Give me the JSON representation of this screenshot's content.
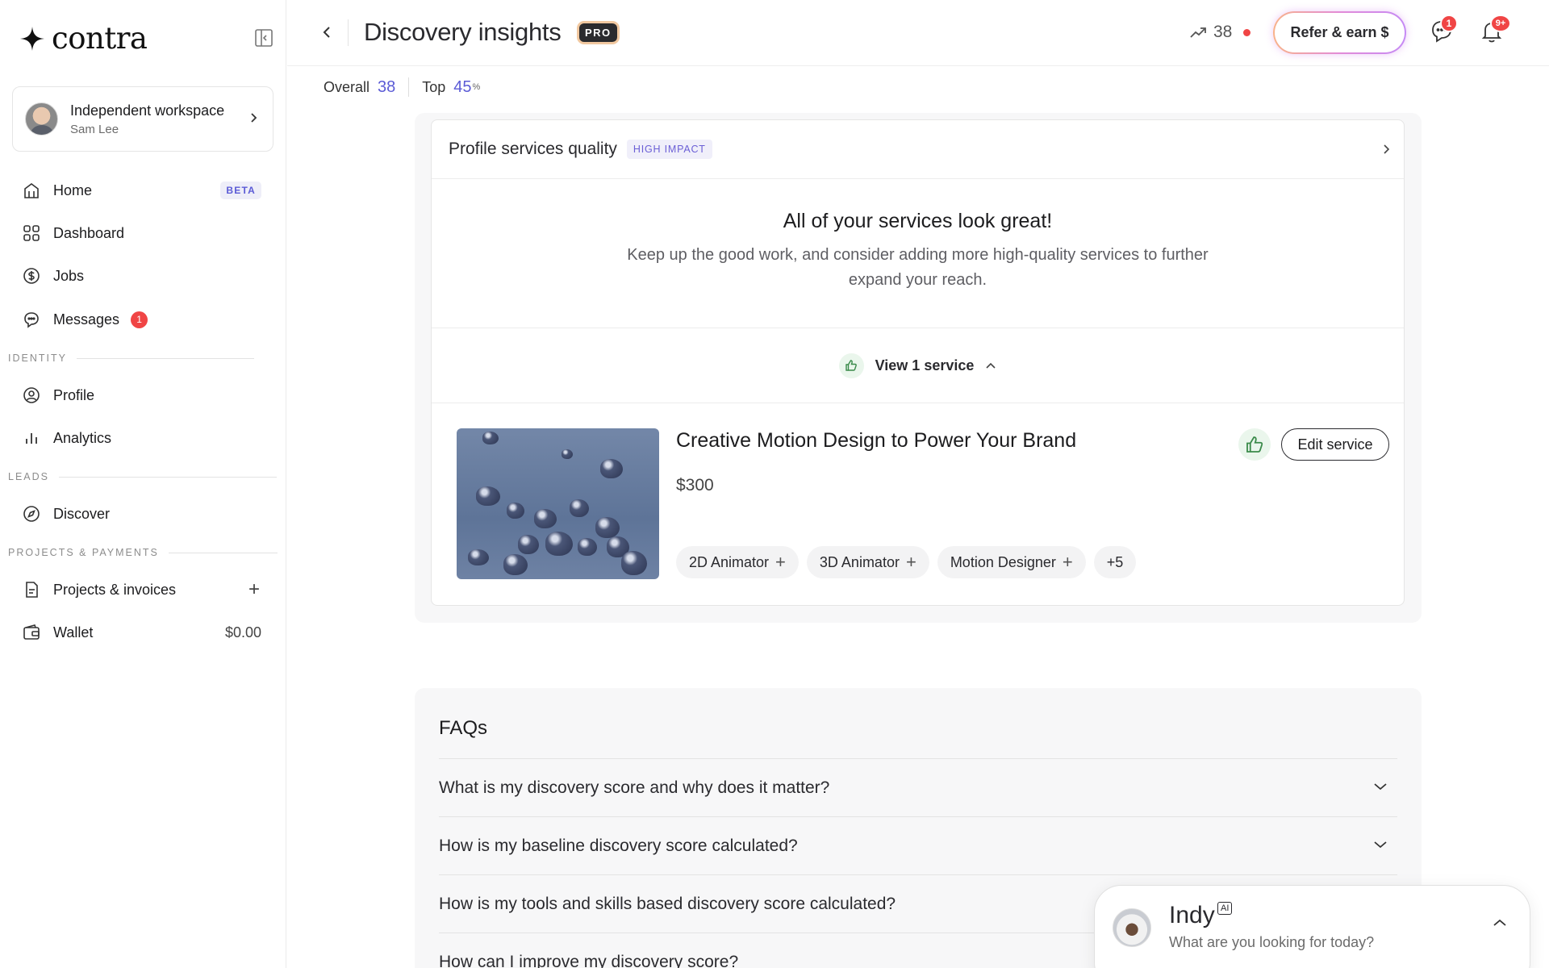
{
  "brand": {
    "name": "contra"
  },
  "workspace": {
    "title": "Independent workspace",
    "user": "Sam Lee"
  },
  "nav": {
    "home": "Home",
    "home_badge": "BETA",
    "dashboard": "Dashboard",
    "jobs": "Jobs",
    "messages": "Messages",
    "messages_count": "1",
    "section_identity": "IDENTITY",
    "profile": "Profile",
    "analytics": "Analytics",
    "section_leads": "LEADS",
    "discover": "Discover",
    "section_projects": "PROJECTS & PAYMENTS",
    "projects": "Projects & invoices",
    "wallet": "Wallet",
    "wallet_balance": "$0.00"
  },
  "header": {
    "title": "Discovery insights",
    "badge": "PRO",
    "score": "38",
    "refer": "Refer & earn $",
    "messages_badge": "1",
    "notifications_badge": "9+"
  },
  "subheader": {
    "overall_label": "Overall",
    "overall_value": "38",
    "top_label": "Top",
    "top_value": "45",
    "top_unit": "%"
  },
  "services": {
    "title": "Profile services quality",
    "impact": "HIGH IMPACT",
    "great_title": "All of your services look great!",
    "great_text": "Keep up the good work, and consider adding more high-quality services to further expand your reach.",
    "view_label": "View 1 service",
    "item": {
      "name": "Creative Motion Design to Power Your Brand",
      "price": "$300",
      "edit": "Edit service",
      "tags": [
        "2D Animator",
        "3D Animator",
        "Motion Designer"
      ],
      "more": "+5"
    }
  },
  "faqs": {
    "title": "FAQs",
    "items": [
      "What is my discovery score and why does it matter?",
      "How is my baseline discovery score calculated?",
      "How is my tools and skills based discovery score calculated?",
      "How can I improve my discovery score?"
    ]
  },
  "indy": {
    "name": "Indy",
    "ai": "AI",
    "prompt": "What are you looking for today?"
  },
  "colors": {
    "accent": "#5b5bd6",
    "danger": "#f04545",
    "success_bg": "#eaf6ec"
  }
}
